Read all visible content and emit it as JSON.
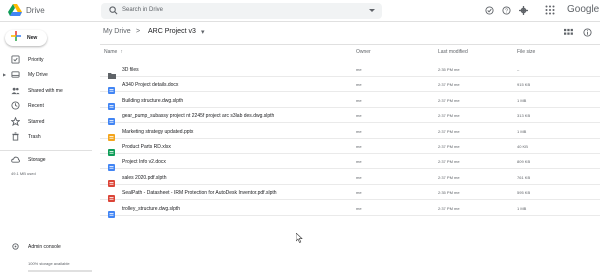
{
  "app": {
    "title": "Drive",
    "brand": "Google"
  },
  "search": {
    "placeholder": "Search in Drive"
  },
  "new_button": {
    "label": "New"
  },
  "sidebar": {
    "items": [
      {
        "label": "Priority",
        "icon": "checkbox-icon"
      },
      {
        "label": "My Drive",
        "icon": "my-drive-icon"
      },
      {
        "label": "Shared with me",
        "icon": "people-icon"
      },
      {
        "label": "Recent",
        "icon": "clock-icon"
      },
      {
        "label": "Starred",
        "icon": "star-icon"
      },
      {
        "label": "Trash",
        "icon": "trash-icon"
      }
    ],
    "storage": {
      "label": "Storage",
      "used": "49.1 MB used"
    },
    "admin": {
      "label": "Admin console",
      "storage_available": "100% storage available"
    }
  },
  "breadcrumb": {
    "parent": "My Drive",
    "separator": ">",
    "current": "ARC Project v3"
  },
  "columns": {
    "name": "Name",
    "owner": "Owner",
    "modified": "Last modified",
    "size": "File size"
  },
  "files": [
    {
      "name": "3D files",
      "type": "folder",
      "owner": "me",
      "modified": "2:35 PM me",
      "size": "–"
    },
    {
      "name": "A340 Project details.docx",
      "type": "docx",
      "owner": "me",
      "modified": "2:37 PM me",
      "size": "915 KB"
    },
    {
      "name": "Building structure.dwg.slpth",
      "type": "file",
      "owner": "me",
      "modified": "2:37 PM me",
      "size": "1 MB"
    },
    {
      "name": "gear_pump_subassy project nt 2245f project arc s3lab des.dwg.slpth",
      "type": "file",
      "owner": "me",
      "modified": "2:37 PM me",
      "size": "313 KB"
    },
    {
      "name": "Marketing strategy updated.pptx",
      "type": "pptx",
      "owner": "me",
      "modified": "2:37 PM me",
      "size": "1 MB"
    },
    {
      "name": "Product Parts RD.xlsx",
      "type": "xlsx",
      "owner": "me",
      "modified": "2:37 PM me",
      "size": "40 KB"
    },
    {
      "name": "Project Info v2.docx",
      "type": "docx",
      "owner": "me",
      "modified": "2:37 PM me",
      "size": "809 KB"
    },
    {
      "name": "sales 2020.pdf.slpth",
      "type": "pdf",
      "owner": "me",
      "modified": "2:37 PM me",
      "size": "761 KB"
    },
    {
      "name": "SealPath - Datasheet - IRM Protection for AutoDesk Inventor.pdf.slpth",
      "type": "pdf",
      "owner": "me",
      "modified": "2:35 PM me",
      "size": "595 KB"
    },
    {
      "name": "trolley_structure.dwg.slpth",
      "type": "file",
      "owner": "me",
      "modified": "2:37 PM me",
      "size": "1 MB"
    }
  ],
  "colors": {
    "folder": "#5f6368",
    "docx": "#4285f4",
    "file": "#4285f4",
    "pptx": "#f4a51c",
    "xlsx": "#0f9d58",
    "pdf": "#db4437"
  }
}
